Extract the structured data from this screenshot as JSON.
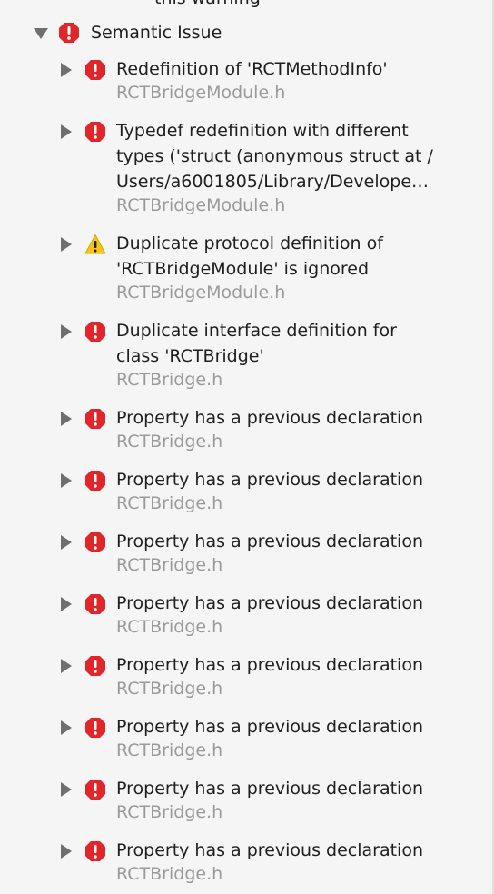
{
  "colors": {
    "background": "#f5f5f5",
    "text": "#1e1e1e",
    "secondary_text": "#9a9a9a",
    "error": "#e0252b",
    "warning": "#f5c518",
    "disclosure": "#6f6f6f"
  },
  "truncated_top_text": "this warning",
  "group": {
    "expanded": true,
    "icon": "error-icon",
    "title": "Semantic Issue"
  },
  "issues": [
    {
      "icon": "error-icon",
      "lines": [
        "Redefinition of 'RCTMethodInfo'"
      ],
      "file": "RCTBridgeModule.h"
    },
    {
      "icon": "error-icon",
      "lines": [
        "Typedef redefinition with different",
        "types ('struct (anonymous struct at /",
        "Users/a6001805/Library/Develope…"
      ],
      "file": "RCTBridgeModule.h"
    },
    {
      "icon": "warning-icon",
      "lines": [
        "Duplicate protocol definition of",
        "'RCTBridgeModule' is ignored"
      ],
      "file": "RCTBridgeModule.h"
    },
    {
      "icon": "error-icon",
      "lines": [
        "Duplicate interface definition for",
        "class 'RCTBridge'"
      ],
      "file": "RCTBridge.h"
    },
    {
      "icon": "error-icon",
      "lines": [
        "Property has a previous declaration"
      ],
      "file": "RCTBridge.h"
    },
    {
      "icon": "error-icon",
      "lines": [
        "Property has a previous declaration"
      ],
      "file": "RCTBridge.h"
    },
    {
      "icon": "error-icon",
      "lines": [
        "Property has a previous declaration"
      ],
      "file": "RCTBridge.h"
    },
    {
      "icon": "error-icon",
      "lines": [
        "Property has a previous declaration"
      ],
      "file": "RCTBridge.h"
    },
    {
      "icon": "error-icon",
      "lines": [
        "Property has a previous declaration"
      ],
      "file": "RCTBridge.h"
    },
    {
      "icon": "error-icon",
      "lines": [
        "Property has a previous declaration"
      ],
      "file": "RCTBridge.h"
    },
    {
      "icon": "error-icon",
      "lines": [
        "Property has a previous declaration"
      ],
      "file": "RCTBridge.h"
    },
    {
      "icon": "error-icon",
      "lines": [
        "Property has a previous declaration"
      ],
      "file": "RCTBridge.h"
    }
  ]
}
